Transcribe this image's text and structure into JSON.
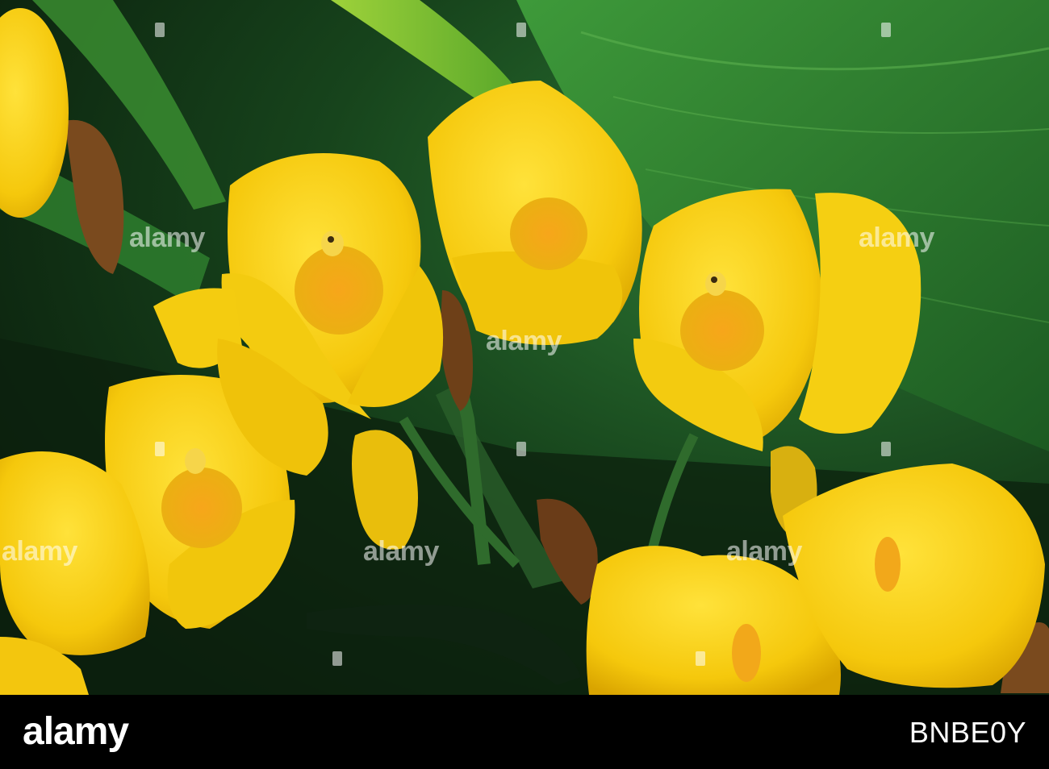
{
  "photo": {
    "subject": "yellow orchid flowers",
    "palette": {
      "petal": "#f5d010",
      "petal_shadow": "#d9a800",
      "center": "#f2a81a",
      "leaf_dark": "#0f3a18",
      "leaf_mid": "#1f6a2a",
      "leaf_light": "#3c8c36",
      "stem": "#2f6b2c",
      "sheath": "#7a4a1e"
    }
  },
  "watermark": {
    "text": "alamy"
  },
  "footer": {
    "logo": "alamy",
    "image_id": "BNBE0Y"
  }
}
